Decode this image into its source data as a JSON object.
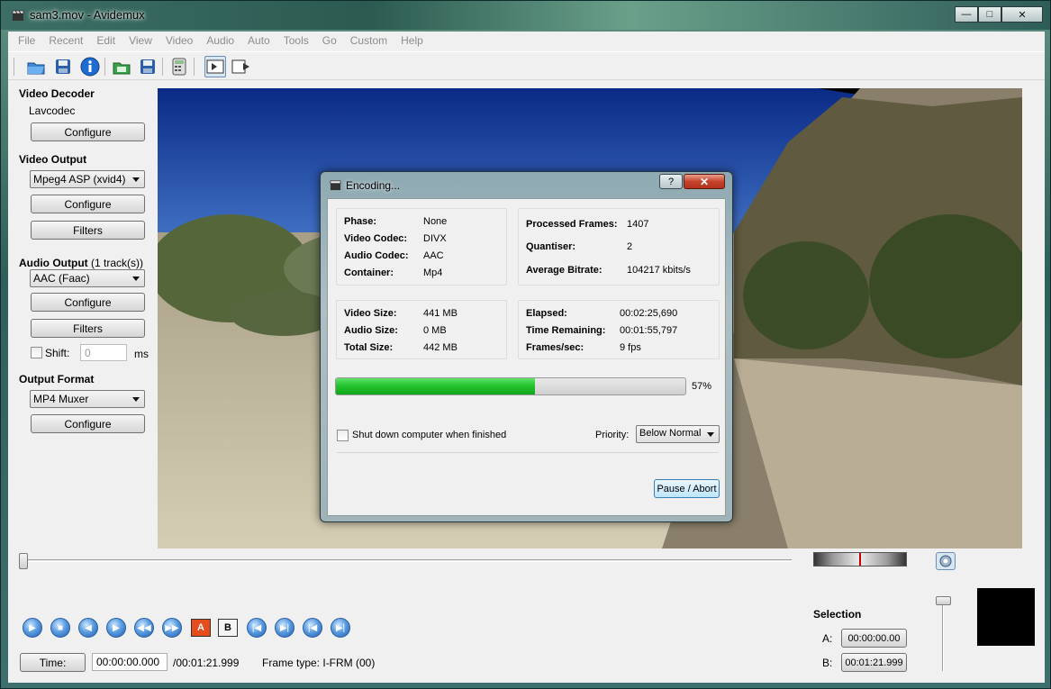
{
  "window": {
    "title": "sam3.mov - Avidemux",
    "minimize": "—",
    "maximize": "□",
    "close": "✕"
  },
  "menu": [
    "File",
    "Recent",
    "Edit",
    "View",
    "Video",
    "Audio",
    "Auto",
    "Tools",
    "Go",
    "Custom",
    "Help"
  ],
  "left_panel": {
    "video_decoder": {
      "heading": "Video Decoder",
      "codec": "Lavcodec",
      "configure": "Configure"
    },
    "video_output": {
      "heading": "Video Output",
      "selected": "Mpeg4 ASP (xvid4)",
      "configure": "Configure",
      "filters": "Filters"
    },
    "audio_output": {
      "heading": "Audio Output",
      "tracks": "(1 track(s))",
      "selected": "AAC (Faac)",
      "configure": "Configure",
      "filters": "Filters",
      "shift_label": "Shift:",
      "shift_value": "0",
      "shift_unit": "ms"
    },
    "output_format": {
      "heading": "Output Format",
      "selected": "MP4 Muxer",
      "configure": "Configure"
    }
  },
  "dialog": {
    "title": "Encoding...",
    "help": "?",
    "close": "✕",
    "info": {
      "phase_label": "Phase:",
      "phase": "None",
      "video_codec_label": "Video Codec:",
      "video_codec": "DIVX",
      "audio_codec_label": "Audio Codec:",
      "audio_codec": "AAC",
      "container_label": "Container:",
      "container": "Mp4"
    },
    "stats": {
      "processed_label": "Processed Frames:",
      "processed": "1407",
      "quantiser_label": "Quantiser:",
      "quantiser": "2",
      "bitrate_label": "Average Bitrate:",
      "bitrate": "104217 kbits/s"
    },
    "sizes": {
      "video_label": "Video Size:",
      "video": "441 MB",
      "audio_label": "Audio Size:",
      "audio": "0 MB",
      "total_label": "Total Size:",
      "total": "442 MB"
    },
    "timing": {
      "elapsed_label": "Elapsed:",
      "elapsed": "00:02:25,690",
      "remaining_label": "Time Remaining:",
      "remaining": "00:01:55,797",
      "fps_label": "Frames/sec:",
      "fps": "9 fps"
    },
    "progress": 0.57,
    "progress_text": "57%",
    "shutdown_label": "Shut down computer when finished",
    "priority_label": "Priority:",
    "priority": "Below Normal",
    "pause_abort": "Pause / Abort"
  },
  "bottom": {
    "ab_markers": {
      "a": "A",
      "b": "B"
    },
    "time_button": "Time:",
    "current_time": "00:00:00.000",
    "total_time": "/00:01:21.999",
    "frame_type": "Frame type:  I-FRM (00)",
    "selection": {
      "heading": "Selection",
      "a_label": "A:",
      "a": "00:00:00.00",
      "b_label": "B:",
      "b": "00:01:21.999"
    }
  },
  "colors": {
    "progress_fill": "#22c02c",
    "accent_blue": "#2b6fc0",
    "close_red": "#c7432b"
  }
}
